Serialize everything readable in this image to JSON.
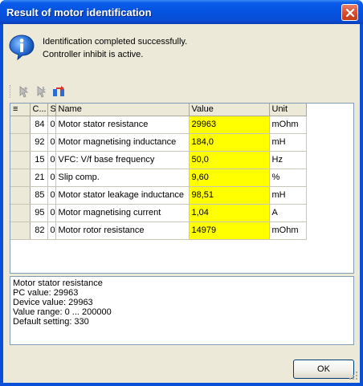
{
  "window": {
    "title": "Result of motor identification"
  },
  "message": {
    "icon": "info-icon",
    "line1": "Identification completed successfully.",
    "line2": "Controller inhibit is active."
  },
  "toolbar": {
    "buttons": [
      "pointer-up-icon",
      "pointer-down-icon",
      "transfer-icon"
    ]
  },
  "grid": {
    "columns": {
      "menu": "≡",
      "code": "C...",
      "subcode": "S",
      "name": "Name",
      "value": "Value",
      "unit": "Unit"
    },
    "rows": [
      {
        "code": "84",
        "subcode": "0",
        "name": "Motor stator resistance",
        "value": "29963",
        "unit": "mOhm"
      },
      {
        "code": "92",
        "subcode": "0",
        "name": "Motor magnetising inductance",
        "value": "184,0",
        "unit": "mH"
      },
      {
        "code": "15",
        "subcode": "0",
        "name": "VFC: V/f base frequency",
        "value": "50,0",
        "unit": "Hz"
      },
      {
        "code": "21",
        "subcode": "0",
        "name": "Slip comp.",
        "value": "9,60",
        "unit": "%"
      },
      {
        "code": "85",
        "subcode": "0",
        "name": "Motor stator leakage inductance",
        "value": "98,51",
        "unit": "mH"
      },
      {
        "code": "95",
        "subcode": "0",
        "name": "Motor magnetising current",
        "value": "1,04",
        "unit": "A"
      },
      {
        "code": "82",
        "subcode": "0",
        "name": "Motor rotor resistance",
        "value": "14979",
        "unit": "mOhm"
      }
    ],
    "value_highlight": "#ffff00"
  },
  "details": {
    "lines": [
      "Motor stator resistance",
      "PC value: 29963",
      "Device value: 29963",
      "Value range: 0 ... 200000",
      "Default setting: 330"
    ]
  },
  "buttons": {
    "ok": "OK"
  }
}
